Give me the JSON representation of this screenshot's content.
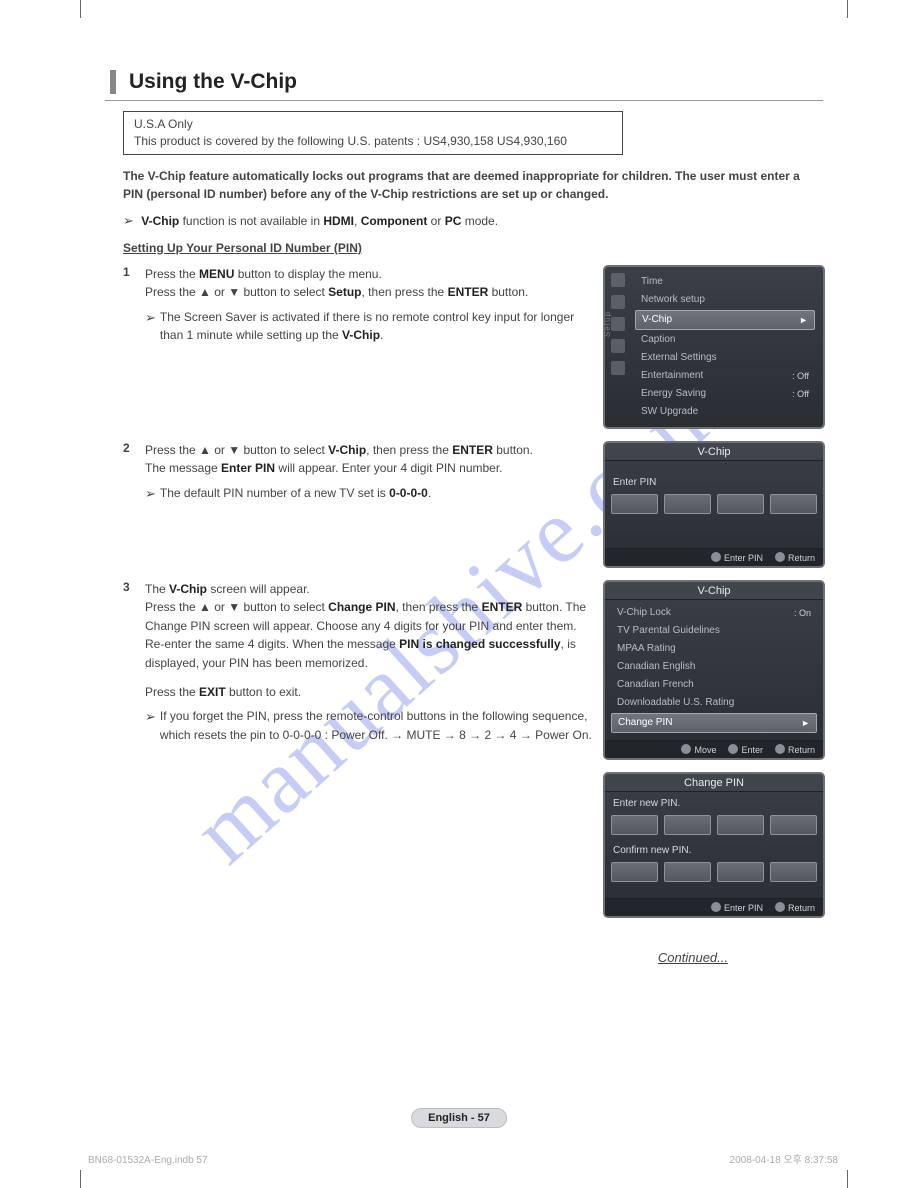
{
  "title": "Using the V-Chip",
  "usa_box": {
    "line1": "U.S.A Only",
    "line2": "This product is covered by the following U.S. patents : US4,930,158 US4,930,160"
  },
  "intro": "The V-Chip feature automatically locks out programs that are deemed inappropriate for children. The user must enter a PIN (personal ID number) before any of the V-Chip restrictions are set up or changed.",
  "mode_note_pre": "V-Chip",
  "mode_note_mid": " function is not available in ",
  "mode_note_b1": "HDMI",
  "mode_note_sep": ", ",
  "mode_note_b2": "Component",
  "mode_note_or": " or ",
  "mode_note_b3": "PC",
  "mode_note_end": " mode.",
  "subhead": "Setting Up Your Personal ID Number (PIN)",
  "steps": {
    "s1": {
      "num": "1",
      "p1a": "Press the ",
      "p1b": "MENU",
      "p1c": " button to display the menu.",
      "p2a": "Press the ▲ or ▼ button to select ",
      "p2b": "Setup",
      "p2c": ", then press the ",
      "p2d": "ENTER",
      "p2e": " button.",
      "sub": "The Screen Saver is activated if there is no remote control key input for longer than 1 minute while setting up the ",
      "sub_b": "V-Chip",
      "sub_end": "."
    },
    "s2": {
      "num": "2",
      "p1a": "Press the ▲ or ▼ button to select ",
      "p1b": "V-Chip",
      "p1c": ", then press the ",
      "p1d": "ENTER",
      "p1e": " button.",
      "p2a": "The message ",
      "p2b": "Enter PIN",
      "p2c": " will appear. Enter your 4 digit PIN number.",
      "sub": "The default PIN number of a new TV set is ",
      "sub_b": "0-0-0-0",
      "sub_end": "."
    },
    "s3": {
      "num": "3",
      "p1a": "The ",
      "p1b": "V-Chip",
      "p1c": " screen will appear.",
      "p2a": "Press the ▲ or ▼ button to select ",
      "p2b": "Change PIN",
      "p2c": ", then press the ",
      "p2d": "ENTER",
      "p2e": " button.",
      "p3": "The Change PIN screen will appear. Choose any 4 digits for your PIN and enter them. Re-enter the same 4 digits. When the message ",
      "p3b": "PIN is changed successfully",
      "p3c": ", is displayed, your PIN has been memorized.",
      "exit_a": "Press the ",
      "exit_b": "EXIT",
      "exit_c": " button to exit.",
      "sub": "If you forget the PIN, press the remote-control buttons in the following sequence, which resets the pin to 0-0-0-0 : Power Off. → MUTE → 8 → 2 → 4 → Power On."
    }
  },
  "osd1": {
    "side": "Setup",
    "rows": [
      {
        "lbl": "Time"
      },
      {
        "lbl": "Network setup"
      },
      {
        "lbl": "V-Chip",
        "hl": true,
        "chev": "►"
      },
      {
        "lbl": "Caption"
      },
      {
        "lbl": "External Settings"
      },
      {
        "lbl": "Entertainment",
        "val": ": Off"
      },
      {
        "lbl": "Energy Saving",
        "val": ": Off"
      },
      {
        "lbl": "SW Upgrade"
      }
    ]
  },
  "osd2": {
    "title": "V-Chip",
    "label": "Enter PIN",
    "foot": [
      "Enter PIN",
      "Return"
    ]
  },
  "osd3": {
    "title": "V-Chip",
    "rows": [
      {
        "lbl": "V-Chip Lock",
        "val": ": On"
      },
      {
        "lbl": "TV Parental Guidelines"
      },
      {
        "lbl": "MPAA Rating"
      },
      {
        "lbl": "Canadian English"
      },
      {
        "lbl": "Canadian French"
      },
      {
        "lbl": "Downloadable U.S. Rating"
      },
      {
        "lbl": "Change PIN",
        "hl": true,
        "chev": "►"
      }
    ],
    "foot": [
      "Move",
      "Enter",
      "Return"
    ]
  },
  "osd4": {
    "title": "Change PIN",
    "label1": "Enter new PIN.",
    "label2": "Confirm new PIN.",
    "foot": [
      "Enter PIN",
      "Return"
    ]
  },
  "continued": "Continued...",
  "pagefoot": "English - 57",
  "footer_left": "BN68-01532A-Eng.indb   57",
  "footer_right": "2008-04-18   오후 8:37:58",
  "watermark": "manualshive.com"
}
